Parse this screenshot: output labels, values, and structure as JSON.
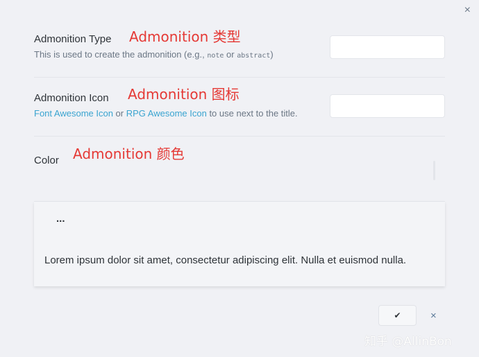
{
  "modal": {
    "close_icon": "×",
    "colors": {
      "link": "#3aa4d0",
      "annotation": "#e53935",
      "background": "#f0f1f5"
    }
  },
  "settings": {
    "type": {
      "name": "Admonition Type",
      "annotation": "Admonition 类型",
      "desc_prefix": "This is used to create the admonition (e.g., ",
      "code1": "note",
      "desc_or": " or ",
      "code2": "abstract",
      "desc_suffix": ")",
      "value": ""
    },
    "icon": {
      "name": "Admonition Icon",
      "annotation": "Admonition 图标",
      "link1": "Font Awesome Icon",
      "desc_or": " or ",
      "link2": "RPG Awesome Icon",
      "desc_suffix": " to use next to the title.",
      "value": ""
    },
    "color": {
      "name": "Color",
      "annotation": "Admonition 颜色"
    }
  },
  "preview": {
    "title": "...",
    "body": "Lorem ipsum dolor sit amet, consectetur adipiscing elit. Nulla et euismod nulla."
  },
  "footer": {
    "confirm_icon": "check-icon",
    "confirm_label": "✔",
    "cancel_label": "×"
  },
  "watermark": "知乎 @AllinBon"
}
